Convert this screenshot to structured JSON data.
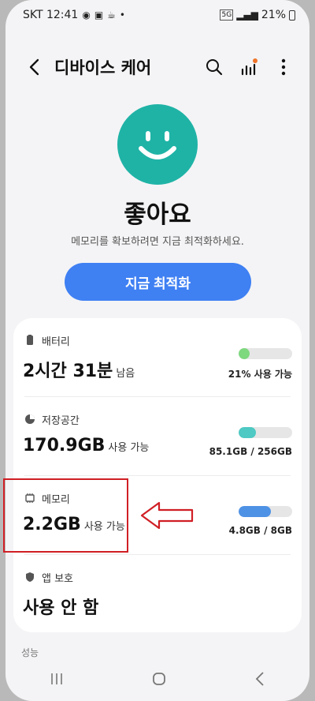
{
  "status_bar": {
    "carrier_time": "SKT 12:41",
    "battery": "21%",
    "network": "5G"
  },
  "header": {
    "title": "디바이스 케어"
  },
  "status": {
    "title": "좋아요",
    "subtitle": "메모리를 확보하려면 지금 최적화하세요.",
    "optimize_label": "지금 최적화"
  },
  "rows": {
    "battery": {
      "label": "배터리",
      "value": "2시간 31분",
      "unit": "남음",
      "bar_text": "21% 사용 가능",
      "level": 0.21,
      "color": "#7ed87e",
      "icon": "battery-icon"
    },
    "storage": {
      "label": "저장공간",
      "value": "170.9GB",
      "unit": "사용 가능",
      "bar_text": "85.1GB / 256GB",
      "level": 0.33,
      "color": "#4ec9c3",
      "icon": "storage-pie-icon"
    },
    "memory": {
      "label": "메모리",
      "value": "2.2GB",
      "unit": "사용 가능",
      "bar_text": "4.8GB / 8GB",
      "level": 0.6,
      "color": "#4e92e6",
      "icon": "memory-chip-icon"
    },
    "app_protection": {
      "label": "앱 보호",
      "value": "사용 안 함",
      "icon": "shield-icon"
    }
  },
  "section": {
    "performance_label": "성능"
  },
  "colors": {
    "accent": "#3f80f3",
    "face": "#1fb3a6",
    "highlight": "#d01f25"
  }
}
